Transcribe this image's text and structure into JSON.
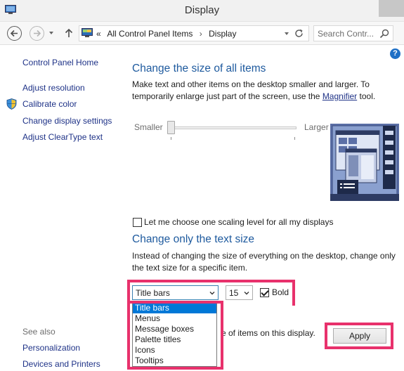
{
  "window": {
    "title": "Display"
  },
  "address": {
    "crumbs": [
      "«",
      "All Control Panel Items",
      "›",
      "Display"
    ],
    "search_placeholder": "Search Contr..."
  },
  "sidebar": {
    "home": "Control Panel Home",
    "links": [
      "Adjust resolution",
      "Calibrate color",
      "Change display settings",
      "Adjust ClearType text"
    ],
    "see_also_label": "See also",
    "see_also": [
      "Personalization",
      "Devices and Printers"
    ]
  },
  "size_section": {
    "heading": "Change the size of all items",
    "text_part1": "Make text and other items on the desktop smaller and larger. To temporarily enlarge just part of the screen, use the ",
    "link": "Magnifier",
    "text_part2": " tool.",
    "slider_min": "Smaller",
    "slider_max": "Larger",
    "slider_value": 0,
    "checkbox_label": "Let me choose one scaling level for all my displays",
    "checkbox_checked": false
  },
  "text_section": {
    "heading": "Change only the text size",
    "description": "Instead of changing the size of everything on the desktop, change only the text size for a specific item.",
    "item_select": "Title bars",
    "size_select": "15",
    "bold_label": "Bold",
    "bold_checked": true,
    "options": [
      "Title bars",
      "Menus",
      "Message boxes",
      "Palette titles",
      "Icons",
      "Tooltips"
    ],
    "selected_option": "Title bars"
  },
  "apply_row": {
    "text": "e of items on this display.",
    "button": "Apply"
  },
  "colors": {
    "highlight": "#e8316c",
    "link": "#1e3287",
    "heading": "#1e5a9e",
    "selection": "#0078d7"
  }
}
